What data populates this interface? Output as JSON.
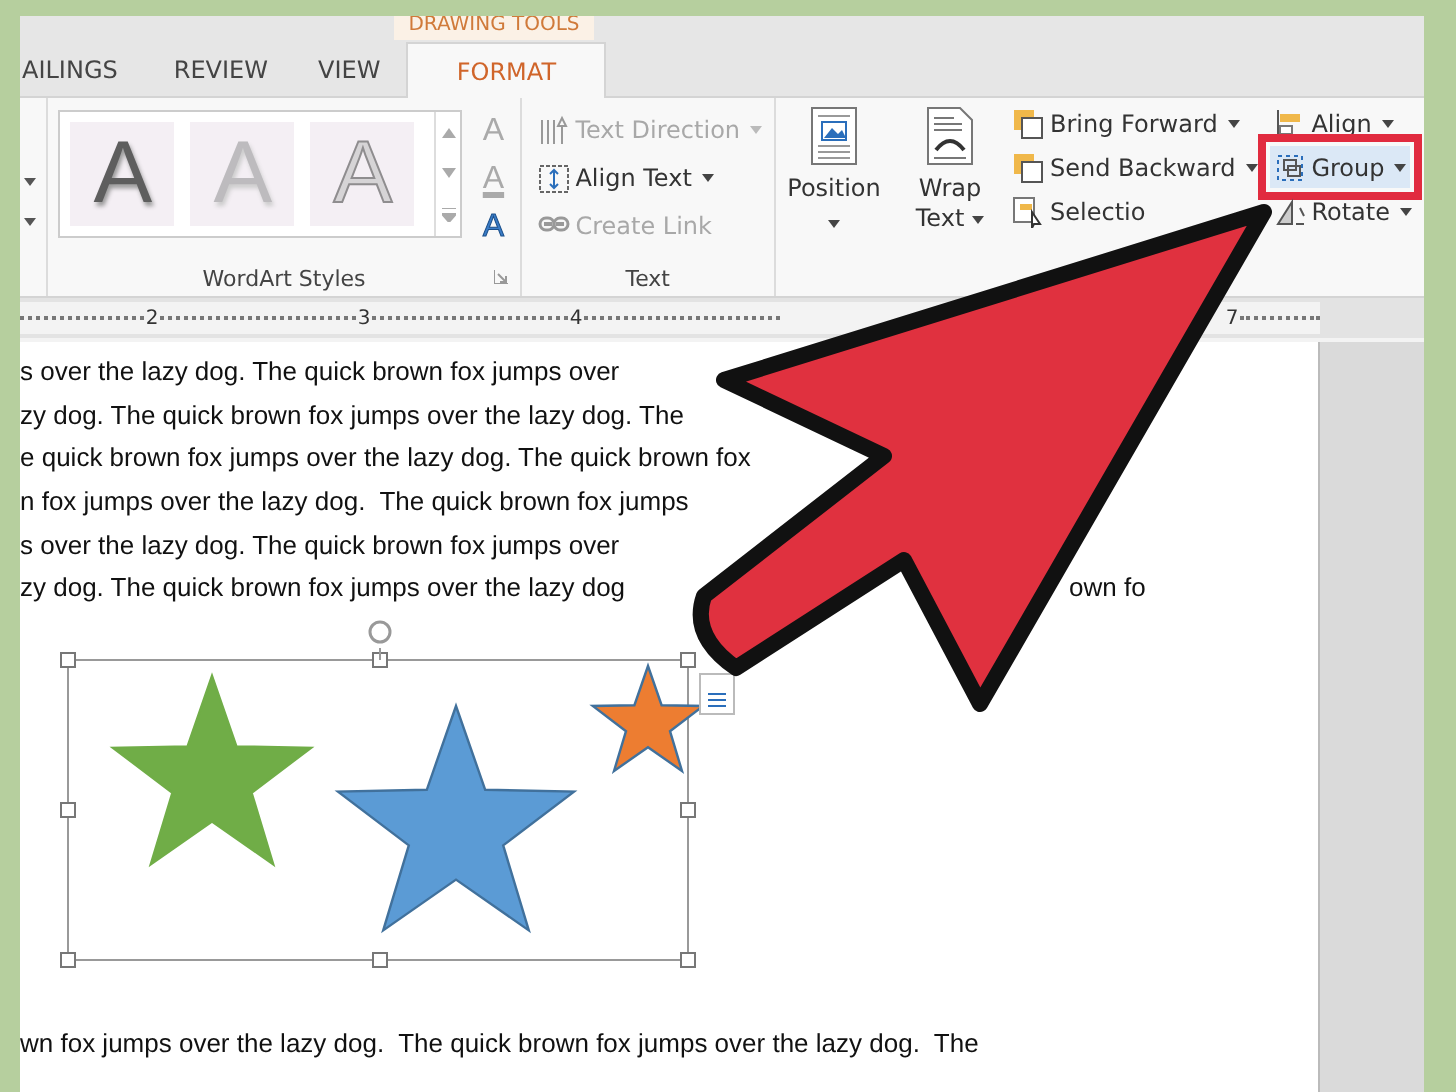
{
  "window": {
    "contextual_tab": "DRAWING TOOLS"
  },
  "tabs": [
    {
      "label": "AILINGS",
      "selected": false
    },
    {
      "label": "REVIEW",
      "selected": false
    },
    {
      "label": "VIEW",
      "selected": false
    },
    {
      "label": "FORMAT",
      "selected": true
    }
  ],
  "ribbon": {
    "wordart_styles": {
      "label": "WordArt Styles",
      "samples": [
        {
          "label": "A",
          "kind": "dark"
        },
        {
          "label": "A",
          "kind": "light"
        },
        {
          "label": "A",
          "kind": "outline"
        }
      ],
      "tools": [
        {
          "label": "A",
          "kind": "fill",
          "disabled": true
        },
        {
          "label": "A",
          "kind": "outline",
          "disabled": true
        },
        {
          "label": "A",
          "kind": "effects",
          "disabled": false
        }
      ]
    },
    "text": {
      "label": "Text",
      "items": [
        {
          "label": "Text Direction",
          "kind": "direction",
          "disabled": true,
          "dropdown": true
        },
        {
          "label": "Align Text",
          "kind": "align",
          "disabled": false,
          "dropdown": true
        },
        {
          "label": "Create Link",
          "kind": "link",
          "disabled": true,
          "dropdown": false
        }
      ]
    },
    "arrange": {
      "large": [
        {
          "lines": [
            "Position"
          ],
          "kind": "position"
        },
        {
          "lines": [
            "Wrap",
            "Text"
          ],
          "kind": "wrap"
        }
      ],
      "small": [
        {
          "label": "Bring Forward",
          "kind": "forward",
          "highlighted": false,
          "dropdown": true
        },
        {
          "label": "Send Backward",
          "kind": "backward",
          "highlighted": false,
          "dropdown": true
        },
        {
          "label": "Selectio",
          "kind": "pane",
          "highlighted": false,
          "dropdown": false
        }
      ],
      "small_2": [
        {
          "label": "Align",
          "kind": "align",
          "highlighted": false,
          "dropdown": true
        },
        {
          "label": "Group",
          "kind": "group",
          "highlighted": true,
          "dropdown": true
        },
        {
          "label": "Rotate",
          "kind": "rotate",
          "highlighted": false,
          "dropdown": true
        }
      ]
    }
  },
  "ruler": [
    {
      "label": "2"
    },
    {
      "label": "3"
    },
    {
      "label": "4"
    },
    {
      "label": "7"
    }
  ],
  "document": {
    "lines": [
      {
        "text": "s over the lazy dog. The quick brown fox jumps over"
      },
      {
        "text": "zy dog. The quick brown fox jumps over the lazy dog. The"
      },
      {
        "text": "e quick brown fox jumps over the lazy dog. The quick brown fox"
      },
      {
        "text": "n fox jumps over the lazy dog.  The quick brown fox jumps"
      },
      {
        "text": "s over the lazy dog. The quick brown fox jumps over"
      },
      {
        "text": "zy dog. The quick brown fox jumps over the lazy dog",
        "tail": "own fo"
      }
    ],
    "shape_group": {
      "selected": true,
      "stars": [
        {
          "color": "#70ad47"
        },
        {
          "color": "#5b9bd5"
        },
        {
          "color": "#ed7d31"
        }
      ]
    },
    "lines_after": [
      {
        "text": "wn fox jumps over the lazy dog.  The quick brown fox jumps over the lazy dog.  The"
      }
    ]
  }
}
